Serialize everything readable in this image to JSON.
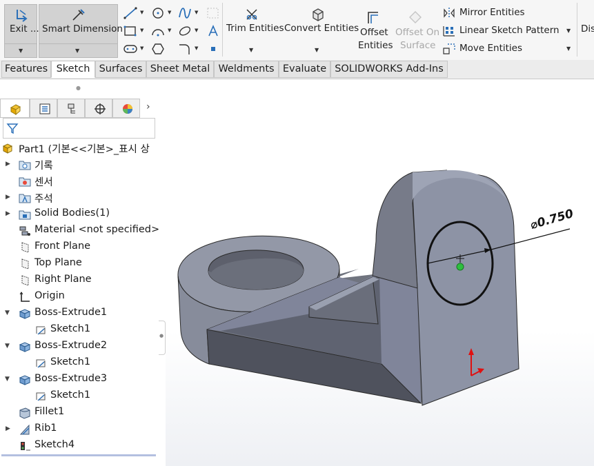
{
  "ribbon": {
    "exit": "Exit ...",
    "smart_dimension": "Smart Dimension",
    "trim_entities": "Trim Entities",
    "convert_entities": "Convert Entities",
    "offset_entities_line1": "Offset",
    "offset_entities_line2": "Entities",
    "offset_surface_line1": "Offset On",
    "offset_surface_line2": "Surface",
    "mirror_entities": "Mirror Entities",
    "linear_pattern": "Linear Sketch Pattern",
    "move_entities": "Move Entities",
    "display_partial": "Dis"
  },
  "tabs": [
    "Features",
    "Sketch",
    "Surfaces",
    "Sheet Metal",
    "Weldments",
    "Evaluate",
    "SOLIDWORKS Add-Ins"
  ],
  "active_tab": "Sketch",
  "tree": {
    "part": "Part1  (기본<<기본>_표시 상",
    "items": [
      {
        "label": "기록"
      },
      {
        "label": "센서"
      },
      {
        "label": "주석"
      },
      {
        "label": "Solid Bodies(1)"
      },
      {
        "label": "Material <not specified>"
      },
      {
        "label": "Front Plane"
      },
      {
        "label": "Top Plane"
      },
      {
        "label": "Right Plane"
      },
      {
        "label": "Origin"
      },
      {
        "label": "Boss-Extrude1"
      },
      {
        "label": "Sketch1"
      },
      {
        "label": "Boss-Extrude2"
      },
      {
        "label": "Sketch1"
      },
      {
        "label": "Boss-Extrude3"
      },
      {
        "label": "Sketch1"
      },
      {
        "label": "Fillet1"
      },
      {
        "label": "Rib1"
      },
      {
        "label": "Sketch4"
      }
    ]
  },
  "dimension": {
    "label": "⌀0.750"
  },
  "colors": {
    "accent": "#2a6fb8",
    "body": "#8c92a3",
    "dark_face": "#5a5e6c"
  }
}
